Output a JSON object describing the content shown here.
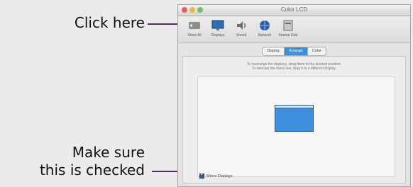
{
  "callouts": {
    "click_here": "Click here",
    "make_sure": "Make sure\nthis is checked"
  },
  "window": {
    "title": "Color LCD",
    "toolbar": [
      {
        "label": "Show All",
        "icon": "show-all-icon"
      },
      {
        "label": "Displays",
        "icon": "displays-icon"
      },
      {
        "label": "Sound",
        "icon": "sound-icon"
      },
      {
        "label": "Network",
        "icon": "network-icon"
      },
      {
        "label": "Startup Disk",
        "icon": "startup-disk-icon"
      }
    ],
    "tabs": [
      {
        "label": "Display",
        "active": false
      },
      {
        "label": "Arrange",
        "active": true
      },
      {
        "label": "Color",
        "active": false
      }
    ],
    "instruction_line1": "To rearrange the displays, drag them to the desired position.",
    "instruction_line2": "To relocate the menu bar, drag it to a different display.",
    "mirror_label": "Mirror Displays",
    "mirror_checked": true
  },
  "colors": {
    "accent_purple": "#5a2a6a",
    "selection_blue": "#3b8ee0",
    "display_blue": "#3e8fde"
  }
}
